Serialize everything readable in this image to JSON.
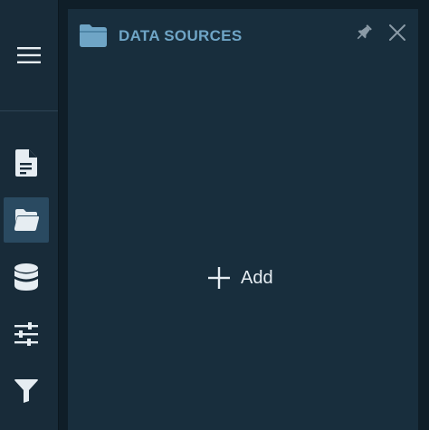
{
  "panel": {
    "title": "DATA SOURCES",
    "title_icon": "folder-icon",
    "add_label": "Add"
  },
  "sidebar": {
    "menu_icon": "hamburger-menu-icon",
    "items": [
      {
        "name": "document",
        "icon": "document-icon",
        "active": false
      },
      {
        "name": "data-sources",
        "icon": "folder-open-icon",
        "active": true
      },
      {
        "name": "database",
        "icon": "database-icon",
        "active": false
      },
      {
        "name": "settings",
        "icon": "sliders-icon",
        "active": false
      },
      {
        "name": "filter",
        "icon": "filter-icon",
        "active": false
      }
    ]
  },
  "colors": {
    "background": "#0f1e28",
    "sidebar": "#182b39",
    "panel": "#182e3d",
    "active_item": "#2a4a61",
    "accent": "#6fa5c6",
    "icon": "#e6edf2",
    "muted_icon": "#8a9aa6"
  }
}
